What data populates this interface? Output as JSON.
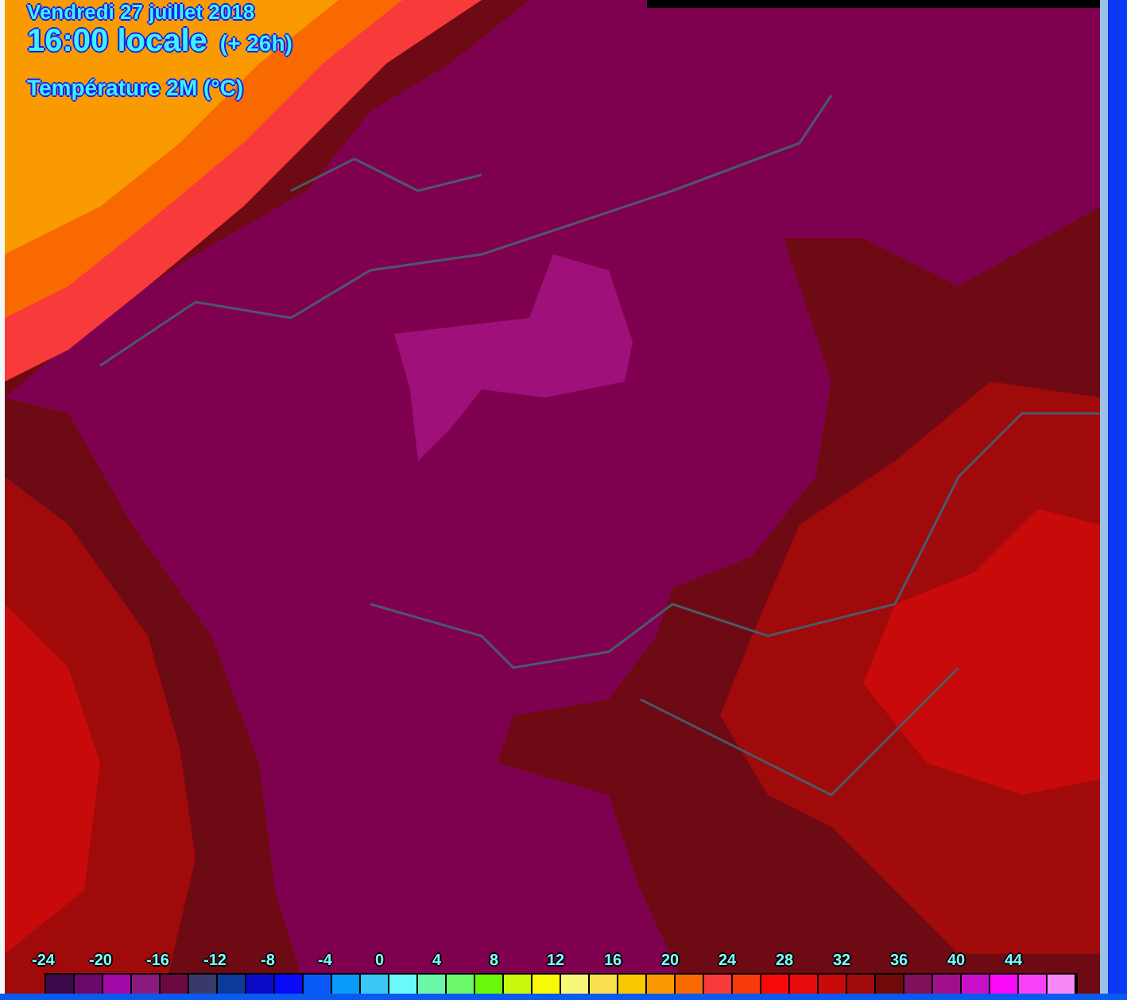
{
  "header": {
    "date": "Vendredi 27 juillet 2018",
    "time": "16:00 locale",
    "lead": "(+ 26h)",
    "variable": "Température 2M (°C)"
  },
  "legend": {
    "ticks": [
      "-24",
      "-20",
      "-16",
      "-12",
      "-8",
      "-4",
      "0",
      "4",
      "8",
      "12",
      "16",
      "20",
      "24",
      "28",
      "32",
      "36",
      "40",
      "44"
    ],
    "swatches": [
      {
        "color": "#3c0a4a"
      },
      {
        "color": "#6a0a6a"
      },
      {
        "color": "#a00aa8"
      },
      {
        "color": "#8a1a80"
      },
      {
        "color": "#6a0a40"
      },
      {
        "color": "#383a6a"
      },
      {
        "color": "#0a3a9a"
      },
      {
        "color": "#0a0ac8"
      },
      {
        "color": "#0a0af8"
      },
      {
        "color": "#0a5af8"
      },
      {
        "color": "#0a9af8"
      },
      {
        "color": "#3ac8f8"
      },
      {
        "color": "#6af8f8"
      },
      {
        "color": "#6af8a8"
      },
      {
        "color": "#6af868"
      },
      {
        "color": "#6af80a"
      },
      {
        "color": "#c8f80a"
      },
      {
        "color": "#f8f80a"
      },
      {
        "color": "#f8f878"
      },
      {
        "color": "#f8e050"
      },
      {
        "color": "#f8c800"
      },
      {
        "color": "#f89a00"
      },
      {
        "color": "#f86a00"
      },
      {
        "color": "#f83a3a"
      },
      {
        "color": "#f83a0a"
      },
      {
        "color": "#f80a0a"
      },
      {
        "color": "#e80a0a"
      },
      {
        "color": "#c80a0a"
      },
      {
        "color": "#a00a0a"
      },
      {
        "color": "#700a0a"
      },
      {
        "color": "#80105a"
      },
      {
        "color": "#a0108a"
      },
      {
        "color": "#c810c8"
      },
      {
        "color": "#f80af8"
      },
      {
        "color": "#f840f8"
      },
      {
        "color": "#f888f8"
      }
    ]
  }
}
